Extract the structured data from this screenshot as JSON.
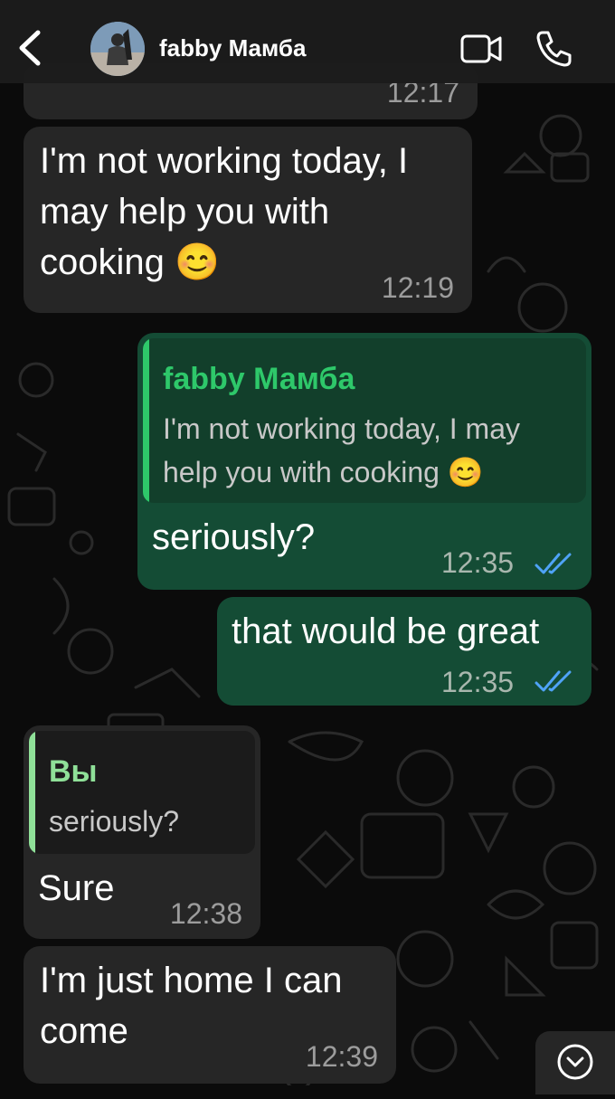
{
  "colors": {
    "incoming_bubble": "#262626",
    "outgoing_bubble": "#144c35",
    "quote_name_green": "#2ec86a",
    "quote_name_light_green": "#8fe098",
    "read_ticks": "#4fa3f7"
  },
  "header": {
    "contact_name": "fabby Мамба",
    "back_icon": "chevron-left-icon",
    "video_icon": "video-camera-icon",
    "call_icon": "phone-icon"
  },
  "messages": [
    {
      "direction": "incoming",
      "time": "12:17"
    },
    {
      "direction": "incoming",
      "text_lines": [
        "I'm not working today, I",
        "may help you with",
        "cooking 😊"
      ],
      "time": "12:19"
    },
    {
      "direction": "outgoing",
      "quote": {
        "name": "fabby Мамба",
        "text_lines": [
          "I'm not working today, I may",
          "help you with cooking 😊"
        ]
      },
      "text": "seriously?",
      "time": "12:35",
      "status": "read"
    },
    {
      "direction": "outgoing",
      "text": "that would be great",
      "time": "12:35",
      "status": "read"
    },
    {
      "direction": "incoming",
      "quote": {
        "name": "Вы",
        "text": "seriously?"
      },
      "text": "Sure",
      "time": "12:38"
    },
    {
      "direction": "incoming",
      "text_lines": [
        "I'm just home I can",
        "come"
      ],
      "time": "12:39"
    }
  ],
  "scroll_button": {
    "icon": "chevron-down-circle-icon"
  }
}
